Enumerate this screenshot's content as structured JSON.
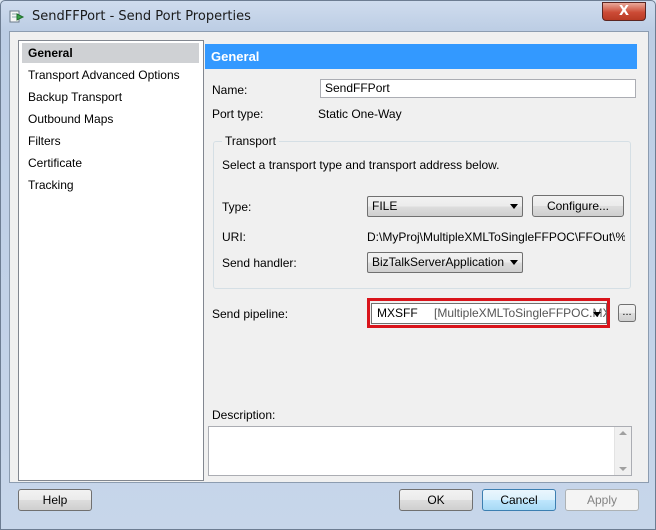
{
  "window": {
    "title": "SendFFPort - Send Port Properties",
    "close_glyph": "X"
  },
  "nav": {
    "items": [
      {
        "label": "General",
        "selected": true
      },
      {
        "label": "Transport Advanced Options"
      },
      {
        "label": "Backup Transport"
      },
      {
        "label": "Outbound Maps"
      },
      {
        "label": "Filters"
      },
      {
        "label": "Certificate"
      },
      {
        "label": "Tracking"
      }
    ]
  },
  "general": {
    "header": "General",
    "name_label": "Name:",
    "name_value": "SendFFPort",
    "port_type_label": "Port type:",
    "port_type_value": "Static One-Way",
    "transport": {
      "legend": "Transport",
      "instruction": "Select a transport type and transport address below.",
      "type_label": "Type:",
      "type_value": "FILE",
      "configure_label": "Configure...",
      "uri_label": "URI:",
      "uri_value": "D:\\MyProj\\MultipleXMLToSingleFFPOC\\FFOut\\%Sourc",
      "send_handler_label": "Send handler:",
      "send_handler_value": "BizTalkServerApplication"
    },
    "send_pipeline_label": "Send pipeline:",
    "send_pipeline_name": "MXSFF",
    "send_pipeline_detail": "[MultipleXMLToSingleFFPOC.MXS",
    "ellipsis_label": "...",
    "description_label": "Description:",
    "description_value": ""
  },
  "footer": {
    "help": "Help",
    "ok": "OK",
    "cancel": "Cancel",
    "apply": "Apply"
  },
  "colors": {
    "header_bg": "#3399ff",
    "highlight_border": "#d9141b",
    "selected_nav_bg": "#cfd1d4"
  }
}
